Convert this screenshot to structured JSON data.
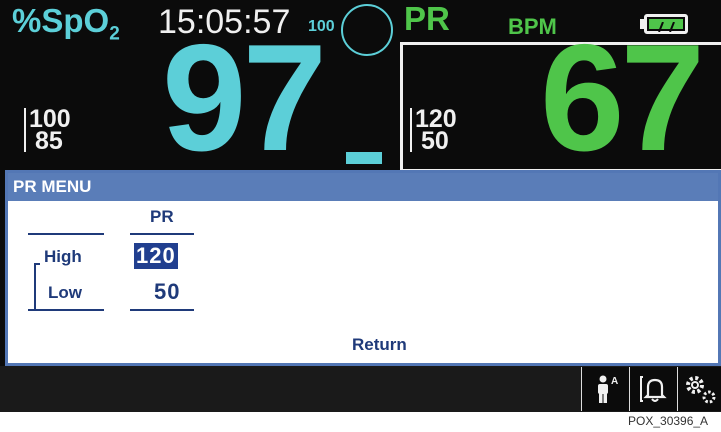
{
  "spo2": {
    "label_main": "%SpO",
    "label_sub": "2",
    "value": "97",
    "limit_high": "100",
    "limit_low": "85",
    "signal_strength": "100",
    "color": "#5ccfd8"
  },
  "clock": {
    "time": "15:05:57"
  },
  "pr": {
    "label": "PR",
    "unit": "BPM",
    "value": "67",
    "limit_high": "120",
    "limit_low": "50",
    "color": "#4fc54a"
  },
  "battery": {
    "icon": "battery-icon",
    "level_fraction": 1.0
  },
  "menu": {
    "title": "PR MENU",
    "column_header": "PR",
    "rows": [
      {
        "label": "High",
        "value": "120",
        "selected": true
      },
      {
        "label": "Low",
        "value": "50",
        "selected": false
      }
    ],
    "return_label": "Return",
    "accent": "#5a7db8"
  },
  "toolbar": {
    "buttons": [
      {
        "icon": "patient-mode-icon",
        "superscript": "A"
      },
      {
        "icon": "alarm-bell-icon"
      },
      {
        "icon": "settings-gears-icon"
      }
    ]
  },
  "caption": "POX_30396_A"
}
